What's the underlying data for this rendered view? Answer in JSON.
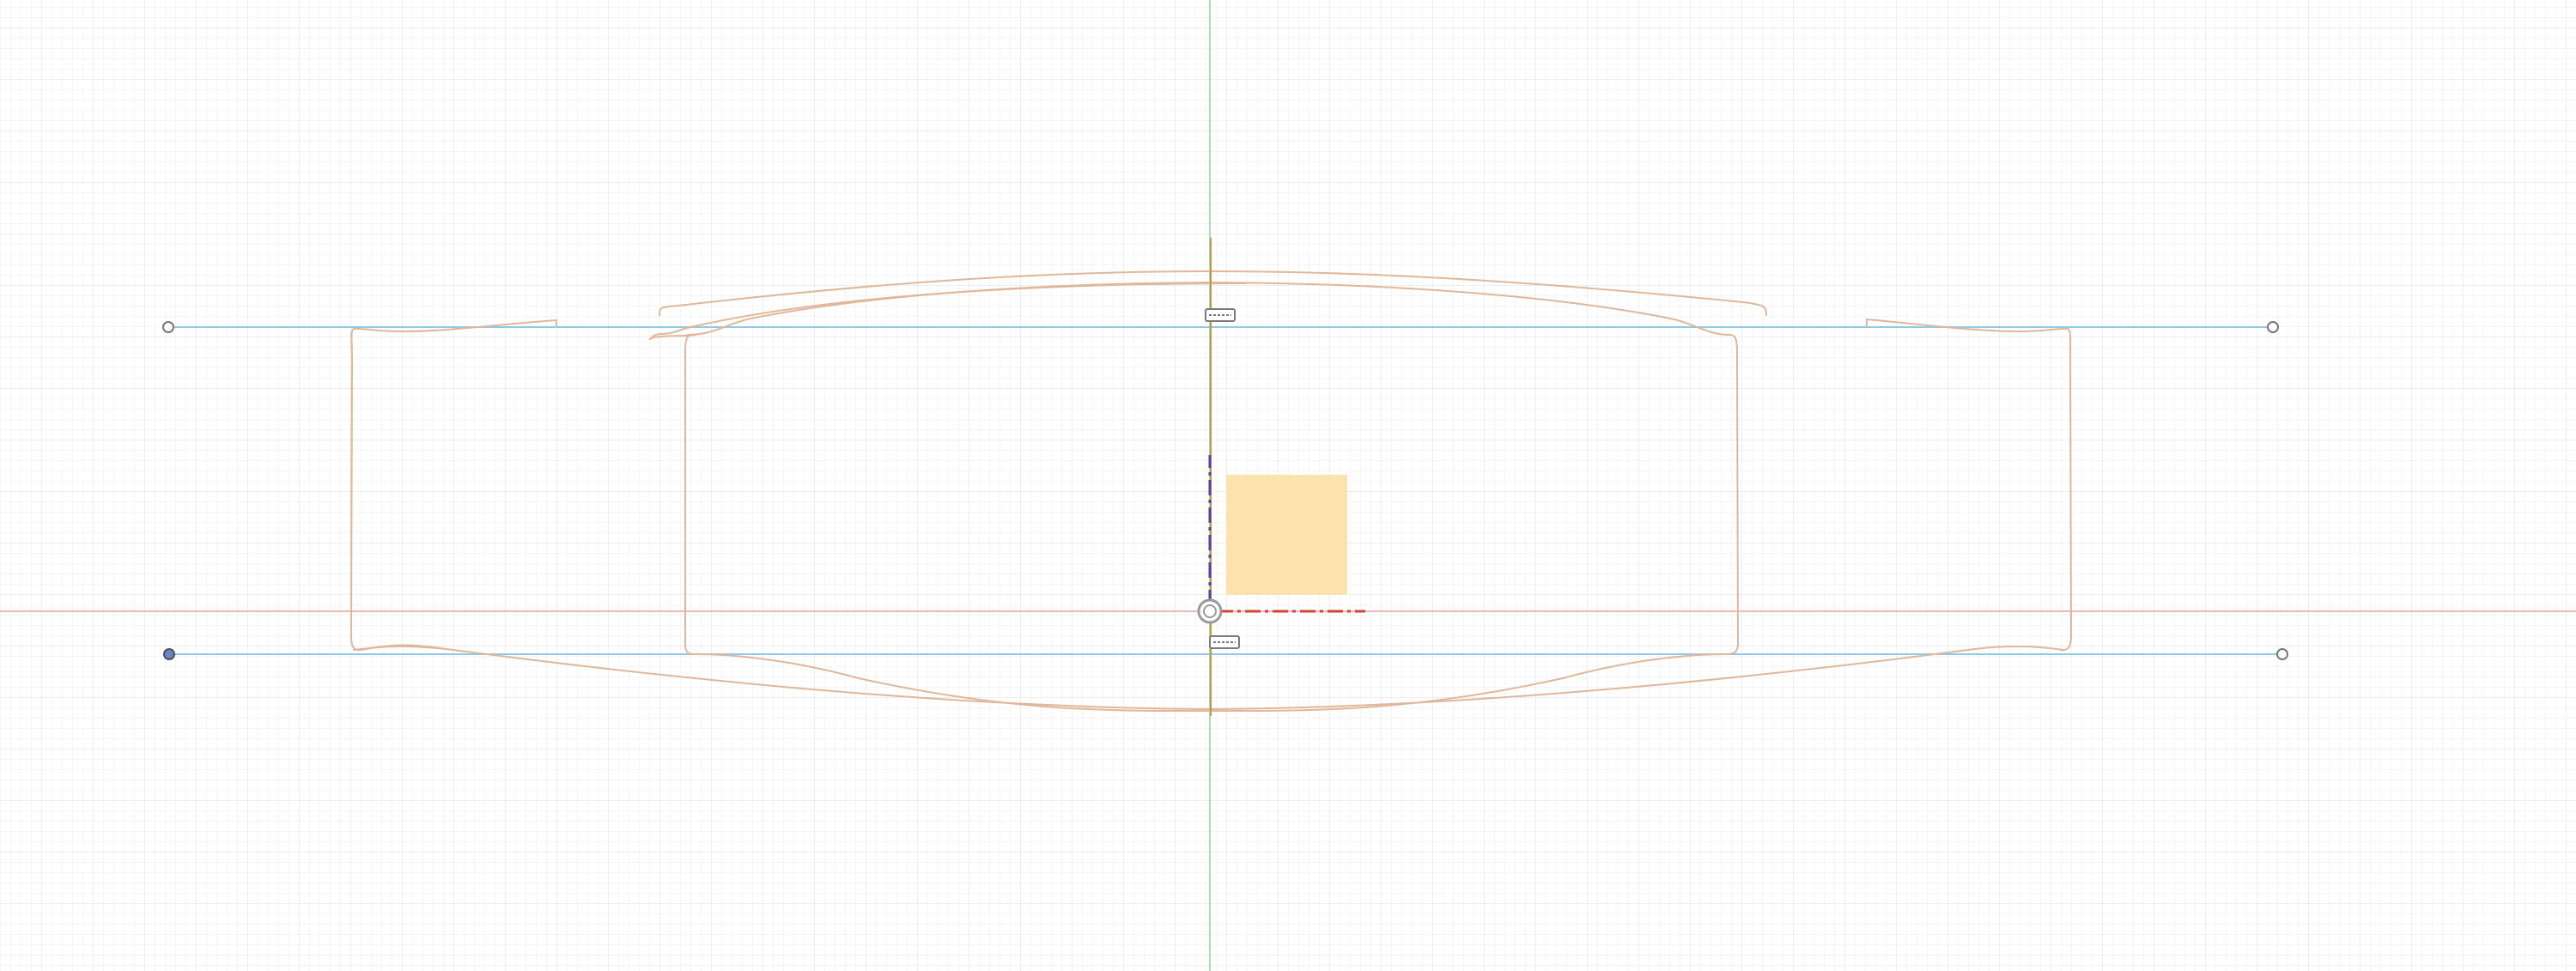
{
  "app": {
    "view": "sketch-canvas"
  },
  "colors": {
    "background": "#ffffff",
    "grid_minor": "#ededed",
    "grid_major": "#dcdcdc",
    "axis_x": "#e8a0a0",
    "axis_y": "#8fd19e",
    "construction_line": "#8ec9e8",
    "sketch_curve": "#dfb79a",
    "profile_fill": "#fde0a8",
    "origin_ring": "#9a9a9a",
    "triad_x": "#d0452f",
    "triad_y": "#5a3fa8",
    "triad_z": "#c8943a",
    "endpoint_fill": "#ffffff",
    "endpoint_selected": "#6a84c8"
  },
  "icons": {
    "origin": "origin-icon",
    "constraint_top": "horizontal-constraint-icon",
    "constraint_bottom": "horizontal-constraint-icon",
    "endpoint": "sketch-point-icon"
  }
}
